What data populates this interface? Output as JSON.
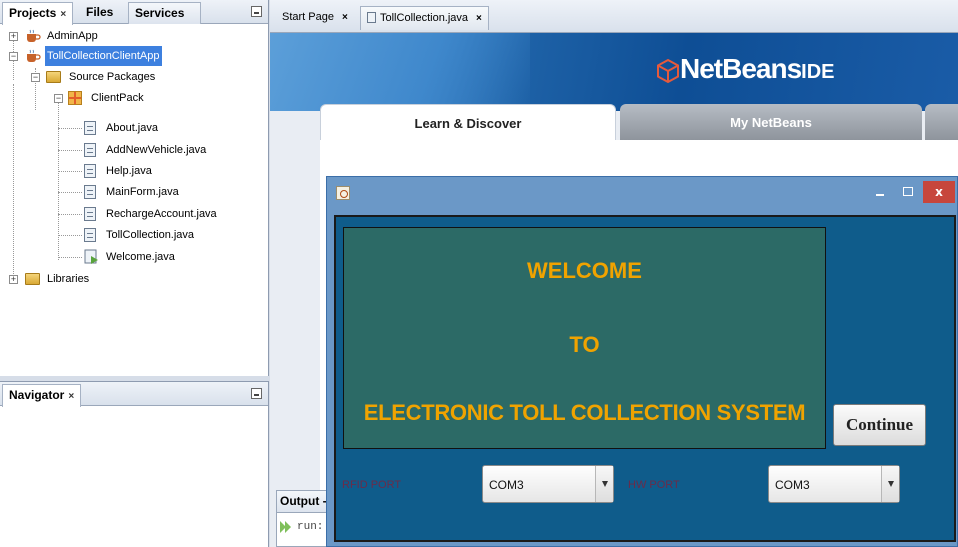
{
  "projects_panel": {
    "tabs": [
      {
        "label": "Projects",
        "close": "×"
      },
      {
        "label": "Files"
      },
      {
        "label": "Services"
      }
    ],
    "tree": {
      "admin_app": "AdminApp",
      "client_app": "TollCollectionClientApp",
      "source_packages": "Source Packages",
      "package": "ClientPack",
      "files": [
        "About.java",
        "AddNewVehicle.java",
        "Help.java",
        "MainForm.java",
        "RechargeAccount.java",
        "TollCollection.java",
        "Welcome.java"
      ],
      "libraries": "Libraries"
    }
  },
  "navigator_panel": {
    "title": "Navigator",
    "close": "×"
  },
  "editor_tabs": [
    {
      "label": "Start Page",
      "close": "×"
    },
    {
      "label": "TollCollection.java",
      "close": "×"
    }
  ],
  "start_page": {
    "logo_main": "NetBeans",
    "logo_suffix": "IDE",
    "tabs": [
      "Learn & Discover",
      "My NetBeans"
    ]
  },
  "output_panel": {
    "title": "Output -",
    "text": "run:"
  },
  "java_window": {
    "close_glyph": "x",
    "welcome_lines": [
      "WELCOME",
      "TO",
      "ELECTRONIC TOLL COLLECTION SYSTEM"
    ],
    "continue_label": "Continue",
    "rfid_label": "RFID PORT",
    "rfid_value": "COM3",
    "hw_label": "HW PORT",
    "hw_value": "COM3"
  },
  "colors": {
    "banner": "#0e4e95",
    "window_title": "#6b98c7",
    "window_body": "#0f5c8b",
    "welcome_panel": "#2c6a66",
    "welcome_text": "#f0a300",
    "selected_node": "#3d80df"
  }
}
